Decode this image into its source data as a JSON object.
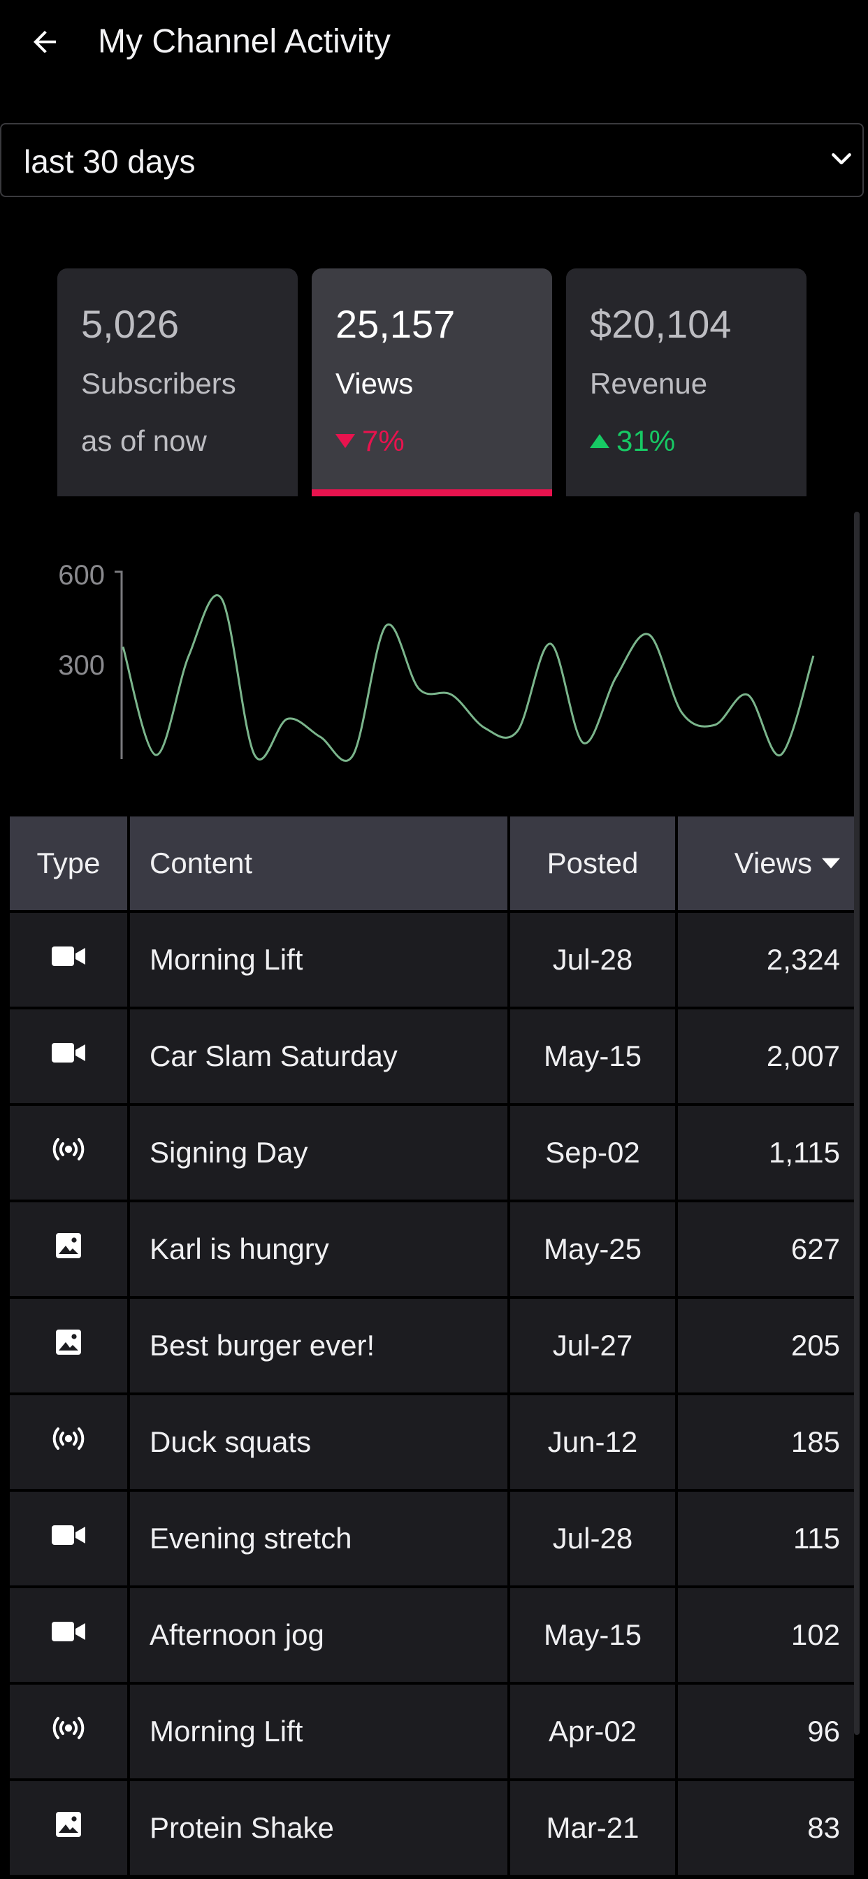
{
  "header": {
    "title": "My Channel Activity",
    "back_icon": "arrow-left-icon"
  },
  "range": {
    "value": "last 30 days",
    "chevron_icon": "chevron-down-icon"
  },
  "cards": [
    {
      "value": "5,026",
      "label": "Subscribers",
      "sub": "as of now"
    },
    {
      "value": "25,157",
      "label": "Views",
      "delta": "7%",
      "direction": "down",
      "color": "#e8134e"
    },
    {
      "value": "$20,104",
      "label": "Revenue",
      "delta": "31%",
      "direction": "up",
      "color": "#17c964"
    }
  ],
  "chart_data": {
    "type": "line",
    "title": "",
    "xlabel": "",
    "ylabel": "",
    "ylim": [
      0,
      600
    ],
    "y_ticks": [
      "600",
      "300"
    ],
    "grid": false,
    "color": "#7bb58c",
    "series": [
      {
        "values": [
          360,
          0,
          330,
          520,
          0,
          120,
          60,
          0,
          430,
          220,
          200,
          90,
          80,
          370,
          40,
          260,
          400,
          140,
          100,
          200,
          0,
          330
        ]
      }
    ]
  },
  "table": {
    "headers": {
      "type": "Type",
      "content": "Content",
      "posted": "Posted",
      "views": "Views"
    },
    "sort_icon": "sort-desc-icon",
    "rows": [
      {
        "type": "video",
        "icon": "video-icon",
        "content": "Morning Lift",
        "posted": "Jul-28",
        "views": "2,324"
      },
      {
        "type": "video",
        "icon": "video-icon",
        "content": "Car Slam Saturday",
        "posted": "May-15",
        "views": "2,007"
      },
      {
        "type": "live",
        "icon": "broadcast-icon",
        "content": "Signing Day",
        "posted": "Sep-02",
        "views": "1,115"
      },
      {
        "type": "image",
        "icon": "image-icon",
        "content": "Karl is hungry",
        "posted": "May-25",
        "views": "627"
      },
      {
        "type": "image",
        "icon": "image-icon",
        "content": "Best burger ever!",
        "posted": "Jul-27",
        "views": "205"
      },
      {
        "type": "live",
        "icon": "broadcast-icon",
        "content": "Duck squats",
        "posted": "Jun-12",
        "views": "185"
      },
      {
        "type": "video",
        "icon": "video-icon",
        "content": "Evening stretch",
        "posted": "Jul-28",
        "views": "115"
      },
      {
        "type": "video",
        "icon": "video-icon",
        "content": "Afternoon jog",
        "posted": "May-15",
        "views": "102"
      },
      {
        "type": "live",
        "icon": "broadcast-icon",
        "content": "Morning Lift",
        "posted": "Apr-02",
        "views": "96"
      },
      {
        "type": "image",
        "icon": "image-icon",
        "content": "Protein Shake",
        "posted": "Mar-21",
        "views": "83"
      }
    ]
  }
}
